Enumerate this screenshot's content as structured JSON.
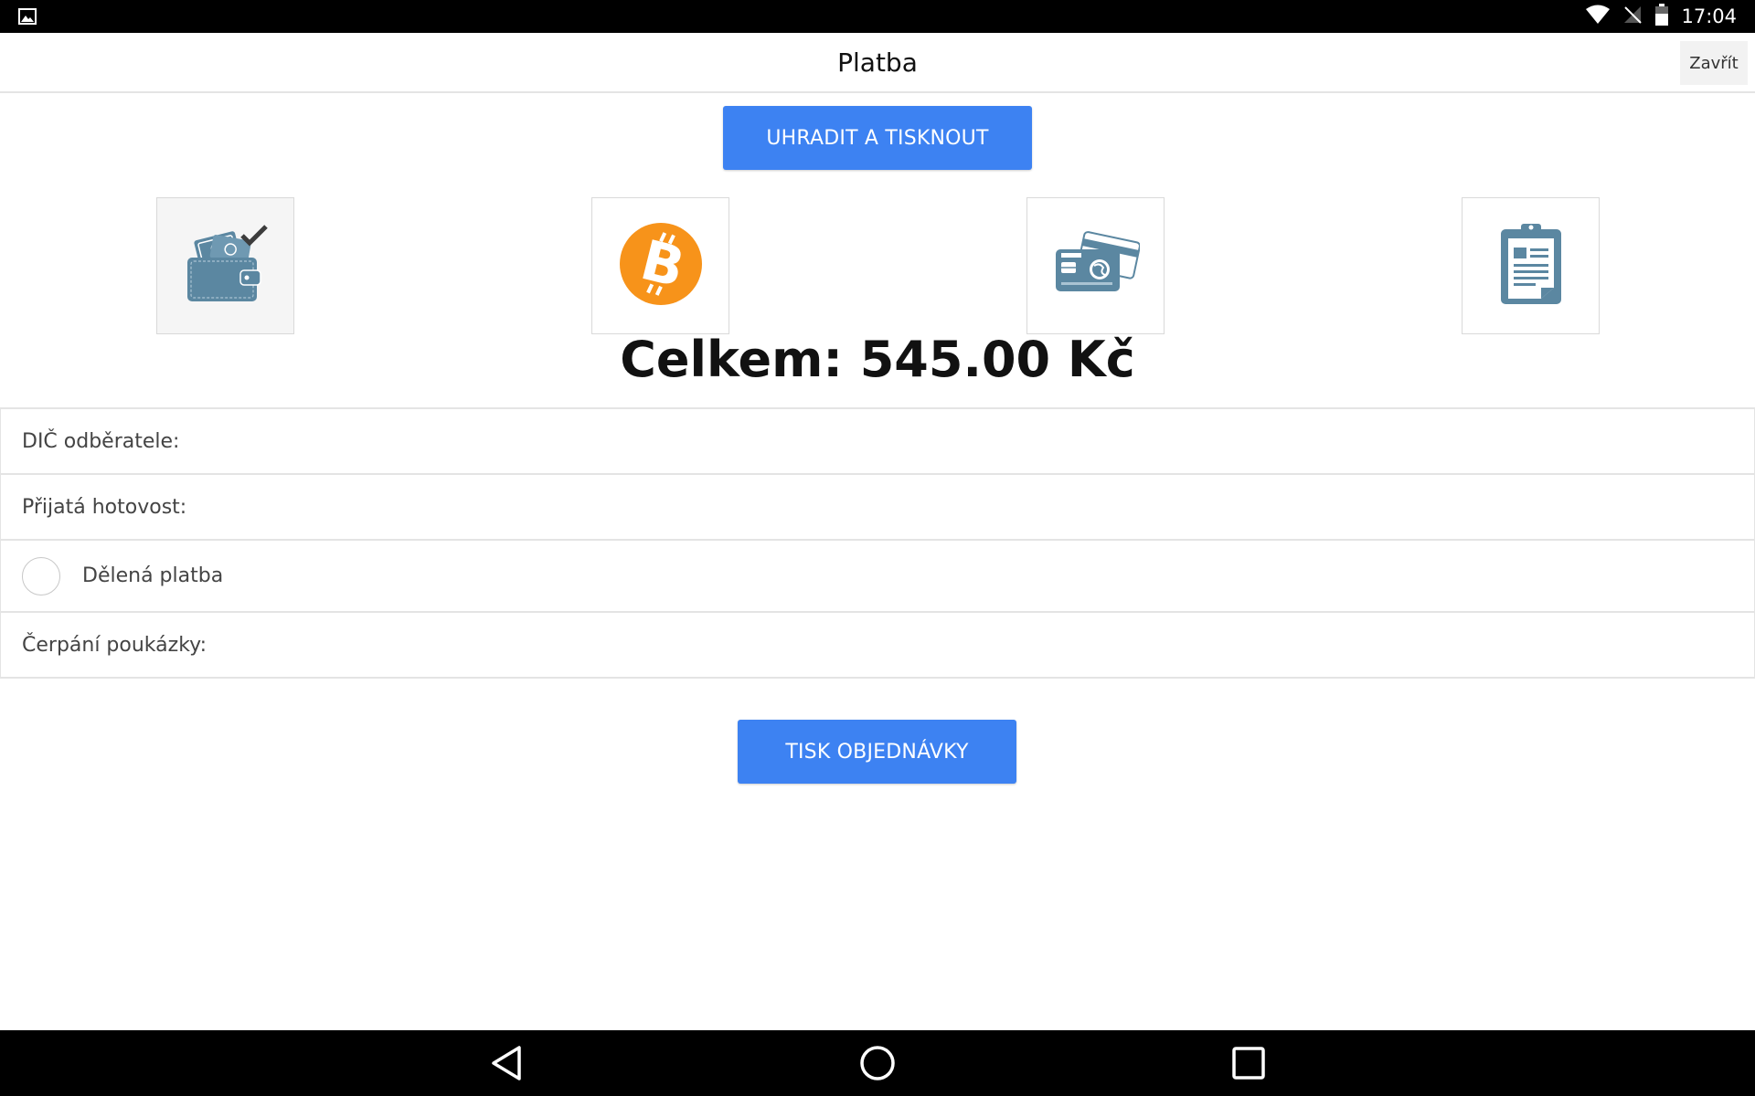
{
  "status_bar": {
    "time": "17:04",
    "icons": [
      "gallery-notification-icon",
      "wifi-icon",
      "no-signal-icon",
      "battery-icon"
    ]
  },
  "header": {
    "title": "Platba",
    "close_label": "Zavřít"
  },
  "actions": {
    "pay_and_print_label": "UHRADIT A TISKNOUT",
    "print_order_label": "TISK OBJEDNÁVKY"
  },
  "payment_methods": [
    {
      "id": "cash",
      "icon": "wallet-cash-icon",
      "selected": true
    },
    {
      "id": "bitcoin",
      "icon": "bitcoin-icon",
      "selected": false
    },
    {
      "id": "card",
      "icon": "credit-card-icon",
      "selected": false
    },
    {
      "id": "invoice",
      "icon": "clipboard-invoice-icon",
      "selected": false
    }
  ],
  "total": {
    "text": "Celkem: 545.00 Kč"
  },
  "form": {
    "customer_vat_label": "DIČ odběratele:",
    "customer_vat_value": "",
    "cash_received_label": "Přijatá hotovost:",
    "cash_received_value": "",
    "split_payment_label": "Dělená platba",
    "split_payment_checked": false,
    "voucher_label": "Čerpání poukázky:",
    "voucher_value": ""
  },
  "colors": {
    "primary": "#3d82f2",
    "icon_slate": "#5b87a1",
    "bitcoin_orange": "#f7931a"
  }
}
